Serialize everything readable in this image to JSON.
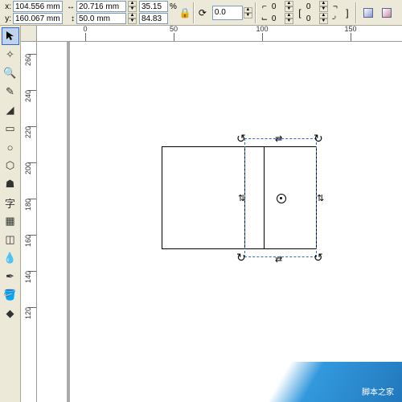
{
  "propertyBar": {
    "x": {
      "label": "x:",
      "value": "104.556 mm"
    },
    "y": {
      "label": "y:",
      "value": "160.067 mm"
    },
    "width": {
      "value": "20.716 mm"
    },
    "height": {
      "value": "50.0 mm"
    },
    "scaleX": {
      "value": "35.15",
      "suffix": "%"
    },
    "scaleY": {
      "value": "84.83"
    },
    "rotation": {
      "value": "0.0"
    },
    "nudgeA": {
      "value": "0"
    },
    "nudgeB": {
      "value": "0"
    },
    "nudgeC": {
      "value": "0"
    },
    "nudgeD": {
      "value": "0"
    }
  },
  "ruler": {
    "hTicks": [
      "0",
      "50",
      "100",
      "150"
    ],
    "vTicks": [
      "260",
      "240",
      "220",
      "200",
      "180",
      "160",
      "140",
      "120"
    ]
  },
  "watermark": "脚本之家"
}
